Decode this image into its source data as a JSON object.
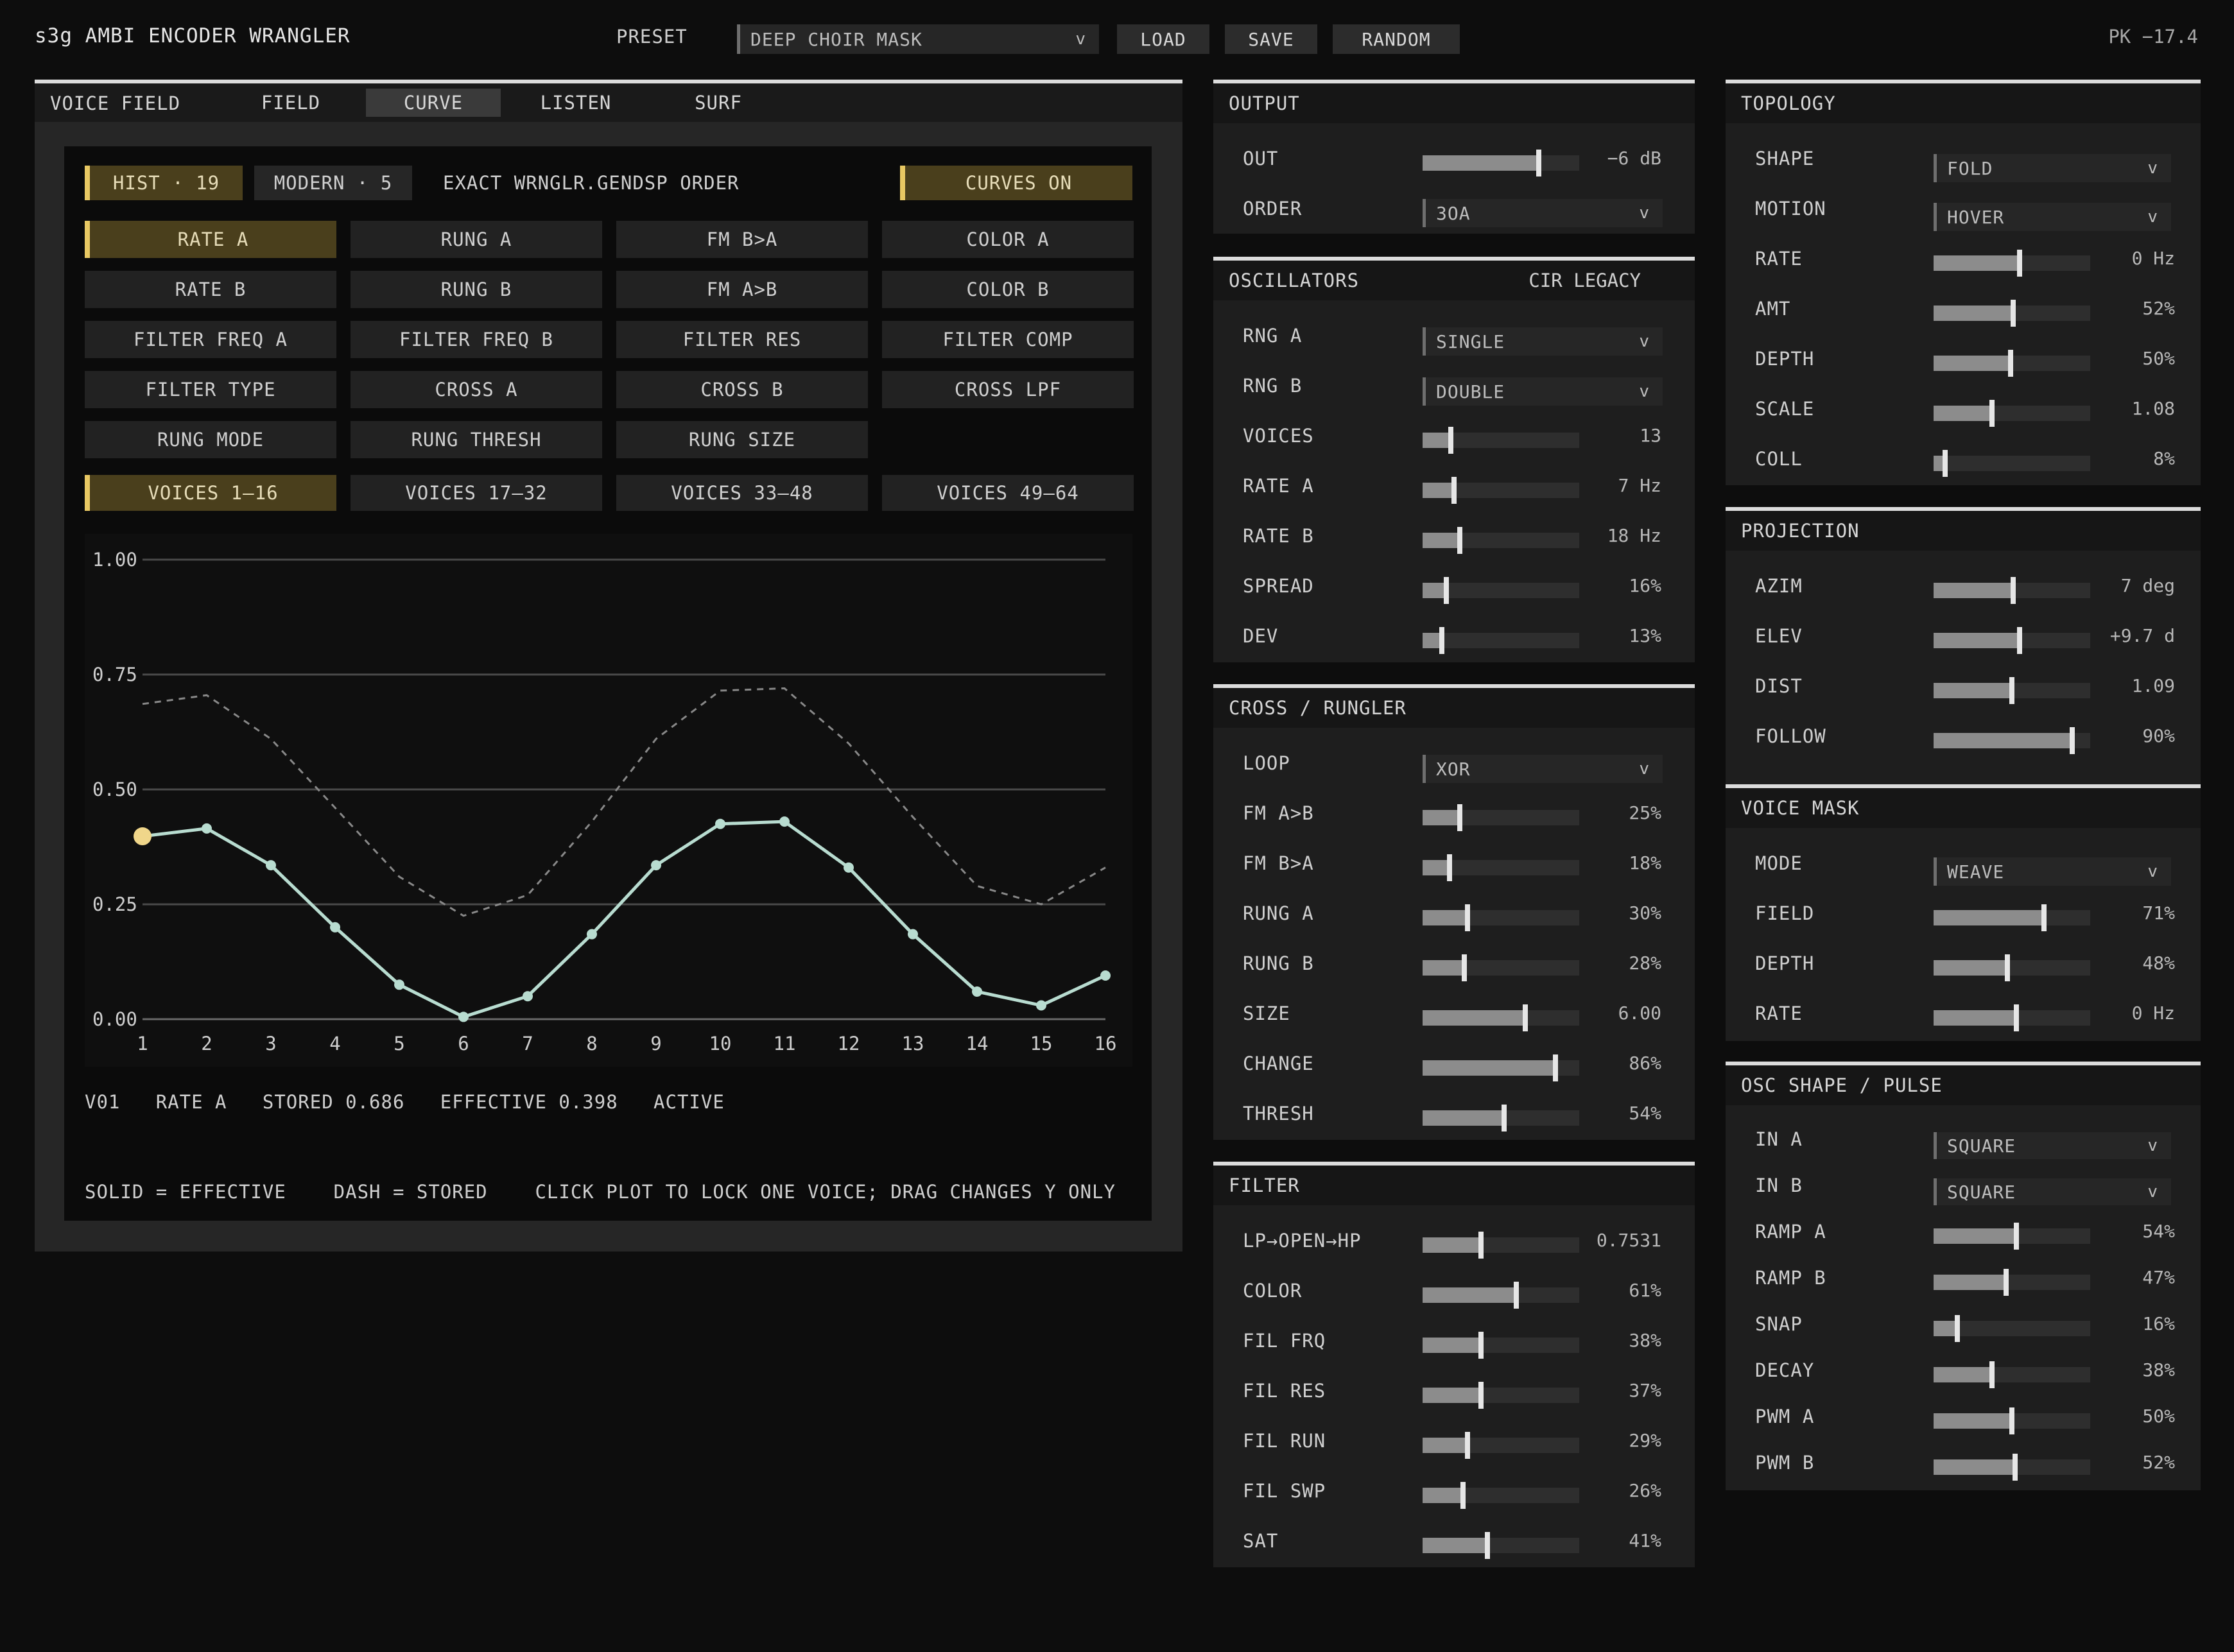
{
  "app": {
    "title": "s3g AMBI ENCODER WRANGLER",
    "peak": "PK −17.4"
  },
  "preset": {
    "label": "PRESET",
    "value": "DEEP CHOIR MASK",
    "load": "LOAD",
    "save": "SAVE",
    "random": "RANDOM"
  },
  "voice_field": {
    "title": "VOICE FIELD",
    "tabs": [
      "FIELD",
      "CURVE",
      "LISTEN",
      "SURF"
    ],
    "active_tab": "CURVE",
    "hist": "HIST · 19",
    "modern": "MODERN · 5",
    "order_text": "EXACT WRNGLR.GENDSP ORDER",
    "curves_toggle": "CURVES ON",
    "params": [
      [
        "RATE A",
        "RUNG A",
        "FM B>A",
        "COLOR A"
      ],
      [
        "RATE B",
        "RUNG B",
        "FM A>B",
        "COLOR B"
      ],
      [
        "FILTER FREQ A",
        "FILTER FREQ B",
        "FILTER RES",
        "FILTER COMP"
      ],
      [
        "FILTER TYPE",
        "CROSS A",
        "CROSS B",
        "CROSS LPF"
      ],
      [
        "RUNG MODE",
        "RUNG THRESH",
        "RUNG SIZE"
      ]
    ],
    "voice_banks": [
      "VOICES 1–16",
      "VOICES 17–32",
      "VOICES 33–48",
      "VOICES 49–64"
    ],
    "status": "V01   RATE A   STORED 0.686   EFFECTIVE 0.398   ACTIVE",
    "legend": "SOLID = EFFECTIVE    DASH = STORED    CLICK PLOT TO LOCK ONE VOICE; DRAG CHANGES Y ONLY"
  },
  "chart_data": {
    "type": "line",
    "x": [
      1,
      2,
      3,
      4,
      5,
      6,
      7,
      8,
      9,
      10,
      11,
      12,
      13,
      14,
      15,
      16
    ],
    "ylim": [
      0,
      1
    ],
    "yticks": [
      "0.00",
      "0.25",
      "0.50",
      "0.75",
      "1.00"
    ],
    "series": [
      {
        "style": "solid",
        "color": "#b8dcd0",
        "values": [
          0.398,
          0.415,
          0.335,
          0.2,
          0.075,
          0.005,
          0.05,
          0.185,
          0.335,
          0.425,
          0.43,
          0.33,
          0.185,
          0.06,
          0.03,
          0.095
        ]
      },
      {
        "style": "dash",
        "color": "#888888",
        "values": [
          0.686,
          0.705,
          0.61,
          0.46,
          0.31,
          0.225,
          0.27,
          0.43,
          0.61,
          0.715,
          0.72,
          0.6,
          0.44,
          0.29,
          0.25,
          0.33
        ]
      }
    ],
    "selected_index": 0,
    "selected_color": "#f0d68a"
  },
  "output": {
    "title": "OUTPUT",
    "out": {
      "label": "OUT",
      "value": "−6 dB",
      "level": 0.75
    },
    "order": {
      "label": "ORDER",
      "value": "3OA"
    }
  },
  "oscillators": {
    "title": "OSCILLATORS",
    "mode": "CIR LEGACY",
    "rng_a": {
      "label": "RNG A",
      "value": "SINGLE"
    },
    "rng_b": {
      "label": "RNG B",
      "value": "DOUBLE"
    },
    "sliders": [
      {
        "label": "VOICES",
        "value": "13",
        "level": 0.17
      },
      {
        "label": "RATE A",
        "value": "7 Hz",
        "level": 0.19
      },
      {
        "label": "RATE B",
        "value": "18 Hz",
        "level": 0.23
      },
      {
        "label": "SPREAD",
        "value": "16%",
        "level": 0.14
      },
      {
        "label": "DEV",
        "value": "13%",
        "level": 0.11
      }
    ]
  },
  "cross": {
    "title": "CROSS / RUNGLER",
    "loop": {
      "label": "LOOP",
      "value": "XOR"
    },
    "sliders": [
      {
        "label": "FM A>B",
        "value": "25%",
        "level": 0.23
      },
      {
        "label": "FM B>A",
        "value": "18%",
        "level": 0.16
      },
      {
        "label": "RUNG A",
        "value": "30%",
        "level": 0.28
      },
      {
        "label": "RUNG B",
        "value": "28%",
        "level": 0.26
      },
      {
        "label": "SIZE",
        "value": "6.00",
        "level": 0.66
      },
      {
        "label": "CHANGE",
        "value": "86%",
        "level": 0.86
      },
      {
        "label": "THRESH",
        "value": "54%",
        "level": 0.52
      }
    ]
  },
  "filter": {
    "title": "FILTER",
    "sliders": [
      {
        "label": "LP→OPEN→HP",
        "value": "0.7531",
        "level": 0.37
      },
      {
        "label": "COLOR",
        "value": "61%",
        "level": 0.6
      },
      {
        "label": "FIL FRQ",
        "value": "38%",
        "level": 0.37
      },
      {
        "label": "FIL RES",
        "value": "37%",
        "level": 0.37
      },
      {
        "label": "FIL RUN",
        "value": "29%",
        "level": 0.28
      },
      {
        "label": "FIL SWP",
        "value": "26%",
        "level": 0.25
      },
      {
        "label": "SAT",
        "value": "41%",
        "level": 0.41
      }
    ]
  },
  "topology": {
    "title": "TOPOLOGY",
    "shape": {
      "label": "SHAPE",
      "value": "FOLD"
    },
    "motion": {
      "label": "MOTION",
      "value": "HOVER"
    },
    "sliders": [
      {
        "label": "RATE",
        "value": "0 Hz",
        "level": 0.55
      },
      {
        "label": "AMT",
        "value": "52%",
        "level": 0.51
      },
      {
        "label": "DEPTH",
        "value": "50%",
        "level": 0.49
      },
      {
        "label": "SCALE",
        "value": "1.08",
        "level": 0.37
      },
      {
        "label": "COLL",
        "value": "8%",
        "level": 0.06
      }
    ]
  },
  "projection": {
    "title": "PROJECTION",
    "sliders": [
      {
        "label": "AZIM",
        "value": "7 deg",
        "level": 0.51
      },
      {
        "label": "ELEV",
        "value": "+9.7 d",
        "level": 0.55
      },
      {
        "label": "DIST",
        "value": "1.09",
        "level": 0.5
      },
      {
        "label": "FOLLOW",
        "value": "90%",
        "level": 0.9
      }
    ]
  },
  "voice_mask": {
    "title": "VOICE MASK",
    "mode": {
      "label": "MODE",
      "value": "WEAVE"
    },
    "sliders": [
      {
        "label": "FIELD",
        "value": "71%",
        "level": 0.71
      },
      {
        "label": "DEPTH",
        "value": "48%",
        "level": 0.47
      },
      {
        "label": "RATE",
        "value": "0 Hz",
        "level": 0.53
      }
    ]
  },
  "osc_shape": {
    "title": "OSC SHAPE / PULSE",
    "in_a": {
      "label": "IN A",
      "value": "SQUARE"
    },
    "in_b": {
      "label": "IN B",
      "value": "SQUARE"
    },
    "sliders": [
      {
        "label": "RAMP A",
        "value": "54%",
        "level": 0.53
      },
      {
        "label": "RAMP B",
        "value": "47%",
        "level": 0.46
      },
      {
        "label": "SNAP",
        "value": "16%",
        "level": 0.14
      },
      {
        "label": "DECAY",
        "value": "38%",
        "level": 0.37
      },
      {
        "label": "PWM A",
        "value": "50%",
        "level": 0.5
      },
      {
        "label": "PWM B",
        "value": "52%",
        "level": 0.52
      }
    ]
  }
}
